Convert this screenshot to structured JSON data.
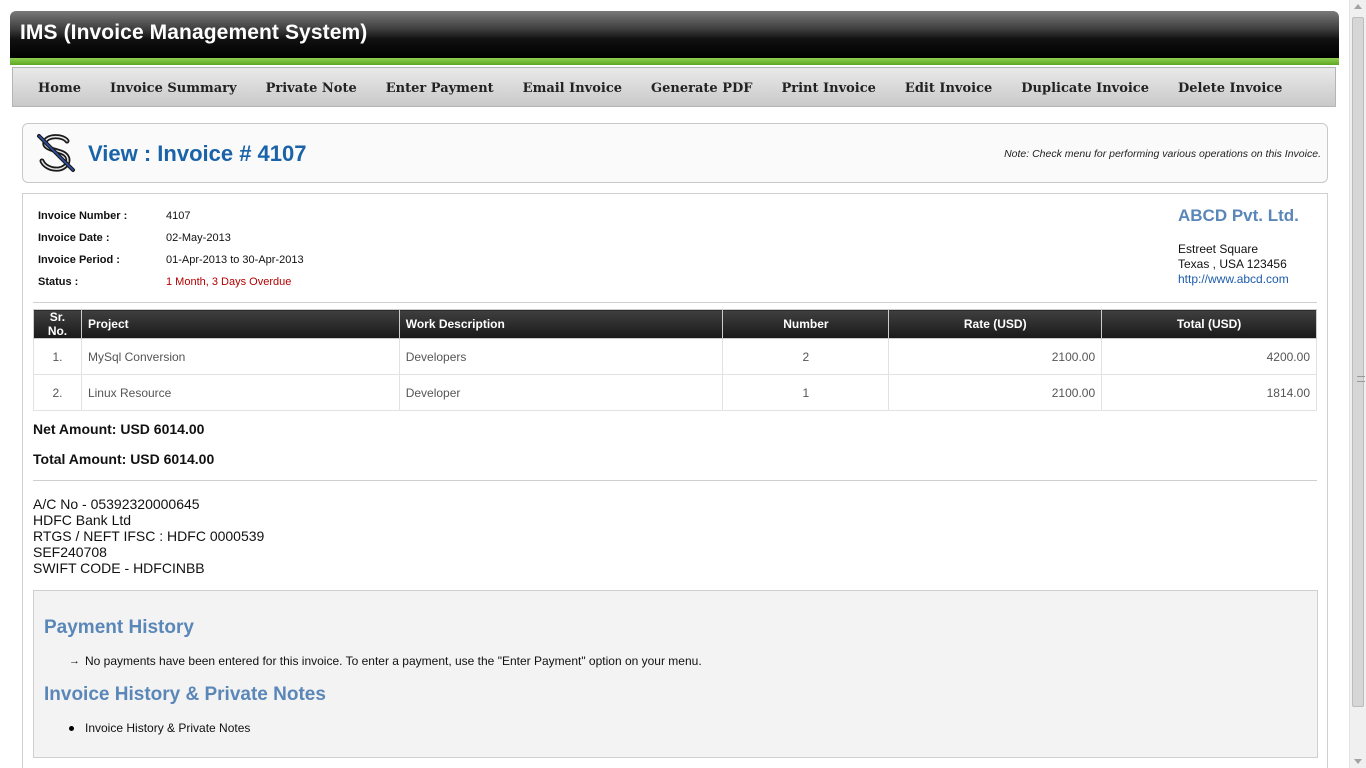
{
  "app": {
    "title": "IMS (Invoice Management System)"
  },
  "nav": [
    "Home",
    "Invoice Summary",
    "Private Note",
    "Enter Payment",
    "Email Invoice",
    "Generate PDF",
    "Print Invoice",
    "Edit Invoice",
    "Duplicate Invoice",
    "Delete Invoice"
  ],
  "page": {
    "title": "View : Invoice # 4107",
    "note": "Note: Check menu for performing various operations on this Invoice."
  },
  "invoice": {
    "number_label": "Invoice Number :",
    "number": "4107",
    "date_label": "Invoice Date :",
    "date": "02-May-2013",
    "period_label": "Invoice Period :",
    "period": "01-Apr-2013 to 30-Apr-2013",
    "status_label": "Status :",
    "status": "1 Month, 3 Days Overdue",
    "status_color": "#b40000"
  },
  "company": {
    "name": "ABCD Pvt. Ltd.",
    "address1": "Estreet Square",
    "address2": "Texas , USA 123456",
    "website": "http://www.abcd.com"
  },
  "items": {
    "headers": [
      "Sr. No.",
      "Project",
      "Work Description",
      "Number",
      "Rate (USD)",
      "Total (USD)"
    ],
    "rows": [
      [
        "1.",
        "MySql Conversion",
        "Developers",
        "2",
        "2100.00",
        "4200.00"
      ],
      [
        "2.",
        "Linux Resource",
        "Developer",
        "1",
        "2100.00",
        "1814.00"
      ]
    ]
  },
  "totals": {
    "net": "Net Amount: USD 6014.00",
    "total": "Total Amount: USD 6014.00"
  },
  "bank": {
    "line1": "A/C No - 05392320000645",
    "line2": "HDFC Bank Ltd",
    "line3": "RTGS / NEFT IFSC : HDFC 0000539",
    "line4": "SEF240708",
    "line5": "SWIFT CODE - HDFCINBB"
  },
  "payment_history": {
    "title": "Payment History",
    "message": "No payments have been entered for this invoice. To enter a payment, use the \"Enter Payment\" option on your menu.",
    "bullet_icon": "arrow-right-icon"
  },
  "invoice_history": {
    "title": "Invoice History & Private Notes",
    "item": "Invoice History & Private Notes"
  },
  "colors": {
    "accent_blue": "#1a63a8",
    "section_blue": "#5b87b8",
    "green_bar": "#6ab52e",
    "table_header": "#2a2a2a"
  }
}
